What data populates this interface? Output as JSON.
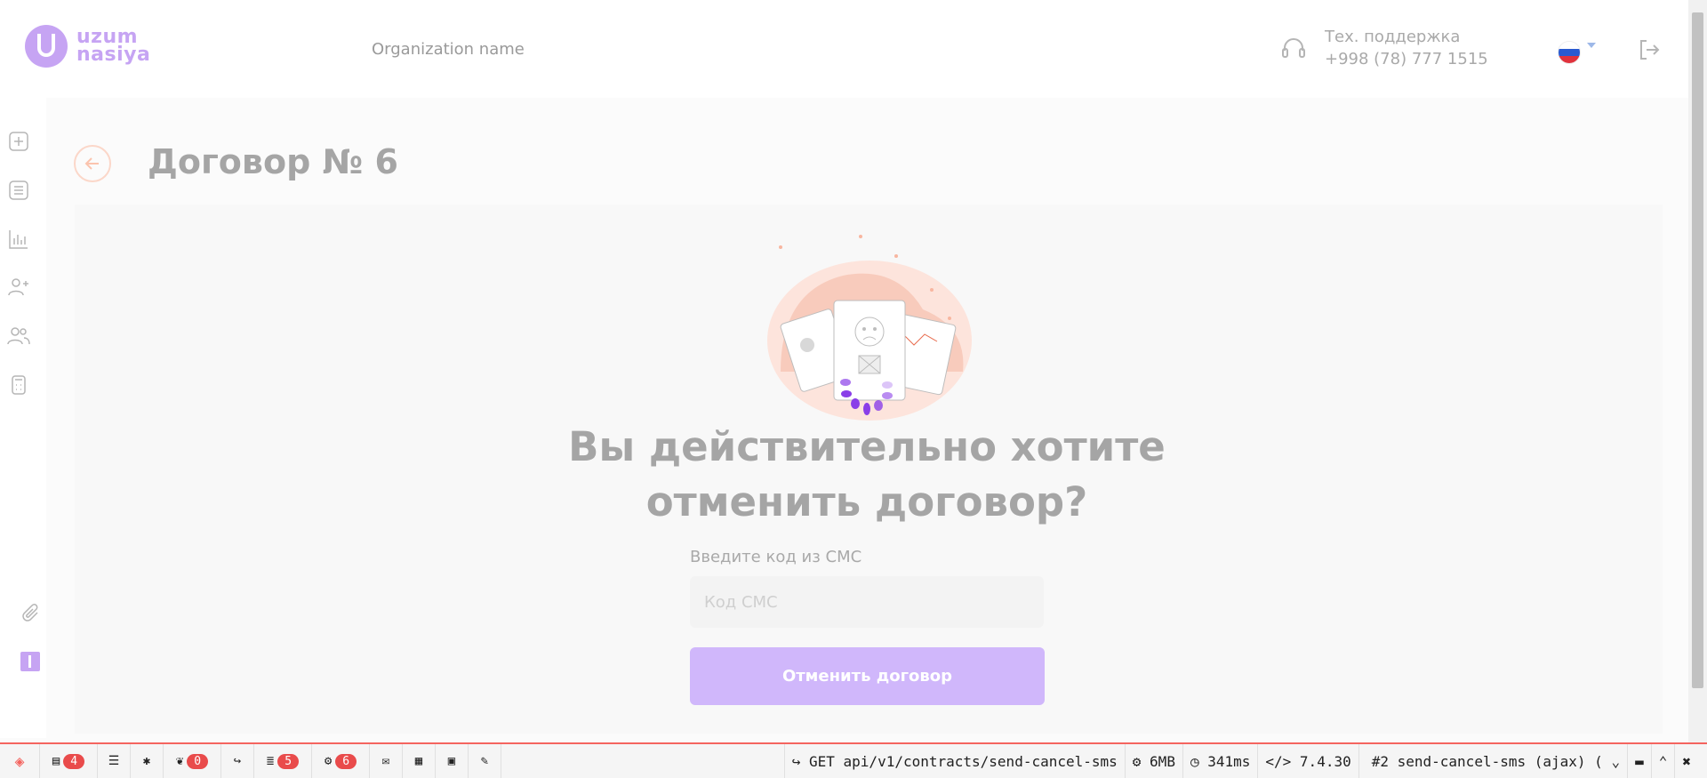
{
  "header": {
    "logo_text_line1": "uzum",
    "logo_text_line2": "nasiya",
    "org_name": "Organization name",
    "support_label": "Тех. поддержка",
    "support_phone": "+998 (78) 777 1515"
  },
  "page": {
    "title": "Договор № 6",
    "question_line1": "Вы действительно хотите",
    "question_line2": "отменить договор?",
    "sms_label": "Введите код из СМС",
    "sms_placeholder": "Код СМС",
    "cancel_button": "Отменить договор"
  },
  "debugbar": {
    "counters": {
      "messages": "4",
      "views": "0",
      "queries": "5",
      "models": "6"
    },
    "request": "GET api/v1/contracts/send-cancel-sms",
    "memory": "6MB",
    "time": "341ms",
    "php_version": "7.4.30",
    "request_select": "#2 send-cancel-sms (ajax) ("
  },
  "icons": {
    "sidebar": [
      "plus-square-icon",
      "list-icon",
      "chart-icon",
      "add-user-icon",
      "users-icon",
      "calculator-icon",
      "paperclip-icon",
      "info-icon"
    ]
  },
  "colors": {
    "accent": "#c6a4f3",
    "button": "#d0b7fb",
    "title": "#a5a5a5",
    "debug_border": "#f4645f",
    "badge": "#e94b4b"
  }
}
